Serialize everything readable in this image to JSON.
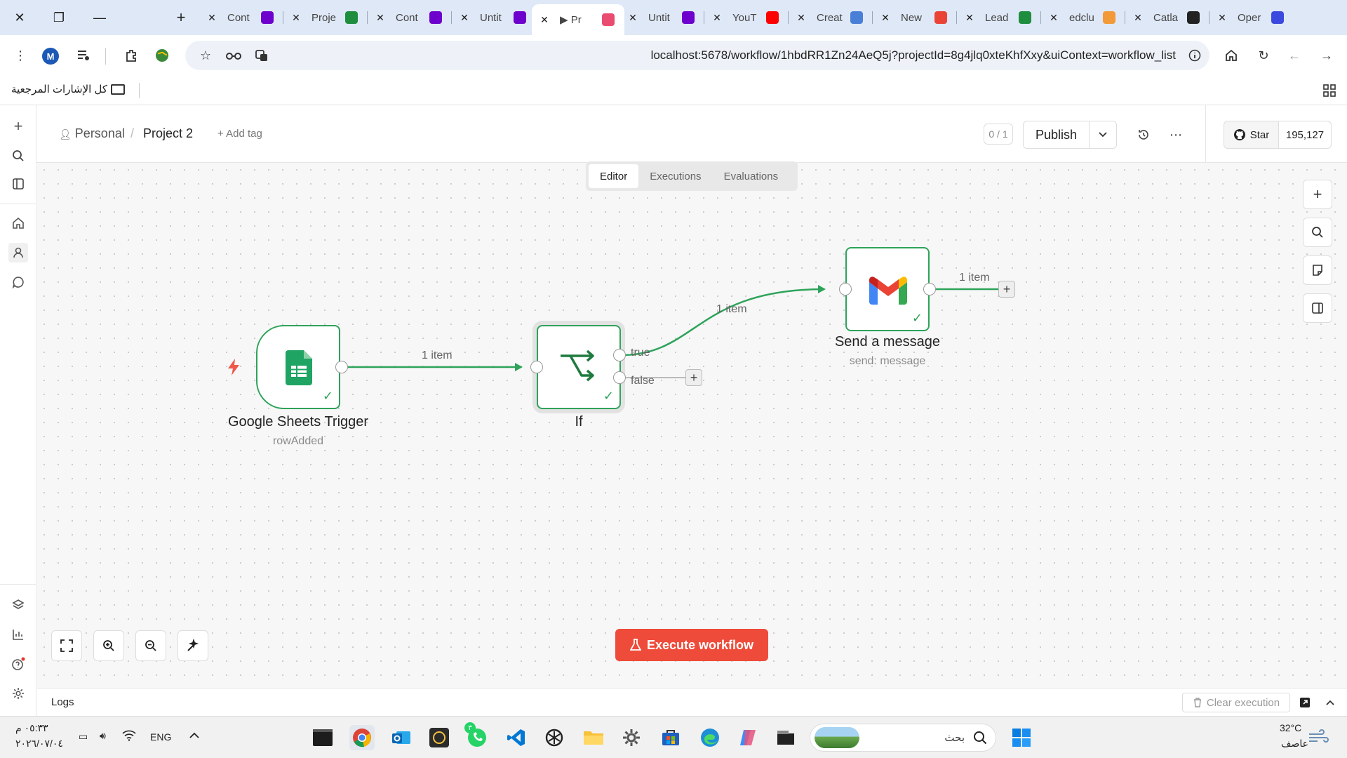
{
  "browser": {
    "tabs": [
      {
        "title": "Cont",
        "favicon": "make-icon",
        "color": "#6d00cc"
      },
      {
        "title": "Proje",
        "favicon": "sheets-icon",
        "color": "#1e8e3e"
      },
      {
        "title": "Cont",
        "favicon": "make-icon",
        "color": "#6d00cc"
      },
      {
        "title": "Untit",
        "favicon": "make-icon",
        "color": "#6d00cc"
      },
      {
        "title": "Pr",
        "favicon": "n8n-icon",
        "color": "#ea4b71",
        "active": true,
        "playing": "▶"
      },
      {
        "title": "Untit",
        "favicon": "make-icon",
        "color": "#6d00cc"
      },
      {
        "title": "YouT",
        "favicon": "youtube-icon",
        "color": "#ff0000"
      },
      {
        "title": "Creat",
        "favicon": "shield-icon",
        "color": "#4a7fd8"
      },
      {
        "title": "New",
        "favicon": "gmail-icon",
        "color": "#ea4335"
      },
      {
        "title": "Lead",
        "favicon": "sheets-icon",
        "color": "#1e8e3e"
      },
      {
        "title": "edclu",
        "favicon": "fox-icon",
        "color": "#f29a38"
      },
      {
        "title": "Catla",
        "favicon": "cat-icon",
        "color": "#222222"
      },
      {
        "title": "Oper",
        "favicon": "openai-icon",
        "color": "#3b49df"
      }
    ],
    "url": "localhost:5678/workflow/1hbdRR1Zn24AeQ5j?projectId=8g4jlq0xteKhfXxy&uiContext=workflow_list",
    "profile_initial": "M",
    "bookmarks_label": "كل الإشارات المرجعية"
  },
  "header": {
    "breadcrumb_personal": "Personal",
    "breadcrumb_sep": "/",
    "breadcrumb_project": "Project 2",
    "add_tag": "+ Add tag",
    "counter": "0 / 1",
    "publish": "Publish",
    "star": "Star",
    "stars_count": "195,127"
  },
  "view_tabs": [
    "Editor",
    "Executions",
    "Evaluations"
  ],
  "workflow": {
    "nodes": [
      {
        "name": "Google Sheets Trigger",
        "subtitle": "rowAdded"
      },
      {
        "name": "If",
        "subtitle": ""
      },
      {
        "name": "Send a message",
        "subtitle": "send: message"
      }
    ],
    "edges": {
      "trigger_to_if": "1 item",
      "if_true_to_gmail": "1 item",
      "gmail_out": "1 item",
      "true_label": "true",
      "false_label": "false"
    }
  },
  "execute_button": "Execute workflow",
  "logs": {
    "label": "Logs",
    "clear_execution": "Clear execution"
  },
  "taskbar": {
    "time": "٠٥:٣٣ م",
    "date": "٢٠٢٦/٠٧/٠٤",
    "language": "ENG",
    "search_placeholder": "بحث",
    "temperature": "32°C",
    "weather": "عاصف",
    "whatsapp_badge": "٣"
  },
  "colors": {
    "accent_green": "#2ea35a",
    "execute_red": "#ef4b3a",
    "n8n_pink": "#ea4b71"
  }
}
